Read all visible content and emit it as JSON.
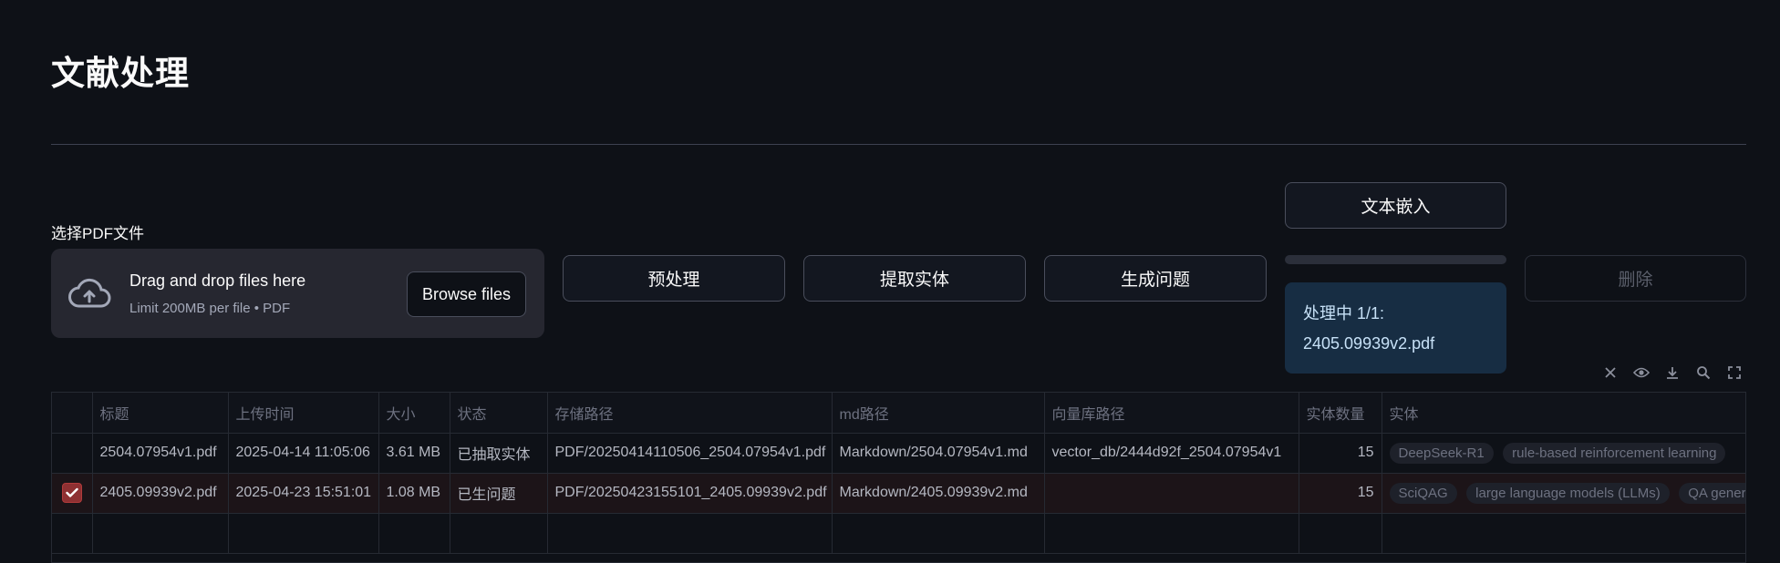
{
  "page": {
    "title": "文献处理"
  },
  "uploader": {
    "label": "选择PDF文件",
    "drop_title": "Drag and drop files here",
    "limit_text": "Limit 200MB per file • PDF",
    "browse_label": "Browse files"
  },
  "actions": {
    "preprocess": "预处理",
    "extract_entities": "提取实体",
    "generate_questions": "生成问题",
    "text_embedding": "文本嵌入",
    "delete": "删除"
  },
  "progress": {
    "fraction": 0.0
  },
  "status_info": {
    "line1": "处理中 1/1:",
    "line2": "2405.09939v2.pdf"
  },
  "toolbar_icons": [
    "close-icon",
    "eye-icon",
    "download-icon",
    "search-icon",
    "fullscreen-icon"
  ],
  "table": {
    "columns": [
      "标题",
      "上传时间",
      "大小",
      "状态",
      "存储路径",
      "md路径",
      "向量库路径",
      "实体数量",
      "实体"
    ],
    "rows": [
      {
        "selected": false,
        "cells": [
          "2504.07954v1.pdf",
          "2025-04-14 11:05:06",
          "3.61 MB",
          "已抽取实体",
          "PDF/20250414110506_2504.07954v1.pdf",
          "Markdown/2504.07954v1.md",
          "vector_db/2444d92f_2504.07954v1",
          "15"
        ],
        "entities": [
          "DeepSeek-R1",
          "rule-based reinforcement learning"
        ]
      },
      {
        "selected": true,
        "cells": [
          "2405.09939v2.pdf",
          "2025-04-23 15:51:01",
          "1.08 MB",
          "已生问题",
          "PDF/20250423155101_2405.09939v2.pdf",
          "Markdown/2405.09939v2.md",
          "",
          "15"
        ],
        "entities": [
          "SciQAG",
          "large language models (LLMs)",
          "QA gener"
        ]
      }
    ]
  },
  "colors": {
    "background": "#0e1117",
    "surface": "#262730",
    "info_bg": "#172d43",
    "accent": "#ff4b4b"
  }
}
